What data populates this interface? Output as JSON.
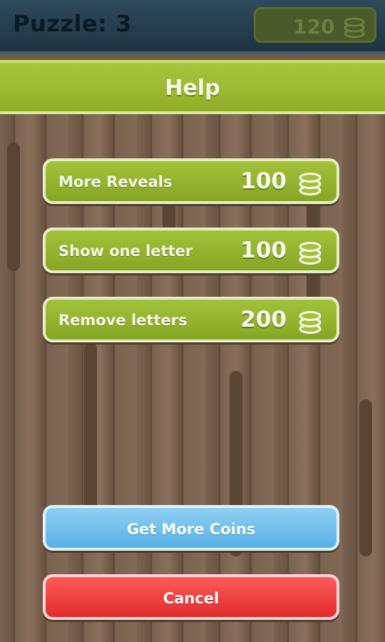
{
  "header": {
    "title": "Puzzle: 3",
    "coins": "120"
  },
  "dialog": {
    "title": "Help"
  },
  "options": [
    {
      "label": "More Reveals",
      "price": "100"
    },
    {
      "label": "Show one letter",
      "price": "100"
    },
    {
      "label": "Remove letters",
      "price": "200"
    }
  ],
  "buttons": {
    "get_more_coins": "Get More Coins",
    "cancel": "Cancel"
  },
  "icons": {
    "coin": "coin-stack-icon"
  },
  "colors": {
    "green": "#95b52c",
    "blue": "#6cbbe9",
    "red": "#f03f3f",
    "topbar": "#253c4b"
  }
}
